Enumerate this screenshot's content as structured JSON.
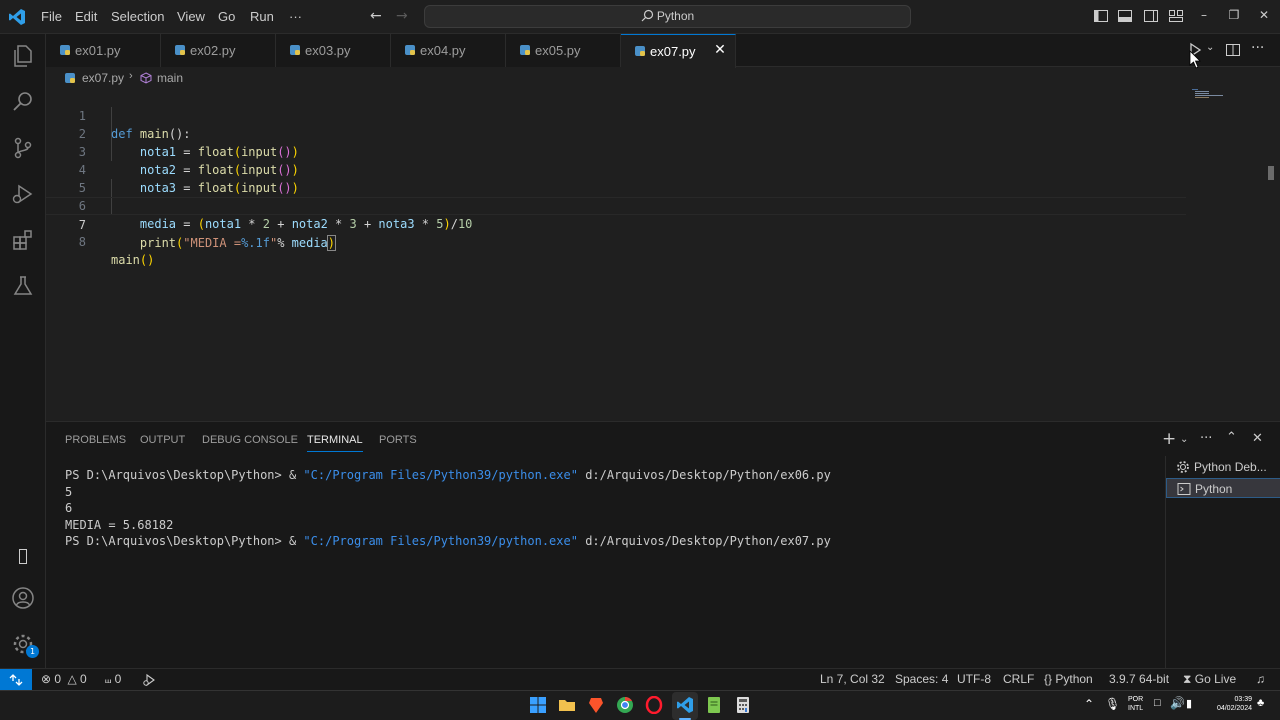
{
  "menu": [
    "File",
    "Edit",
    "Selection",
    "View",
    "Go",
    "Run",
    "···"
  ],
  "search": {
    "text": "Python"
  },
  "tabs": [
    {
      "label": "ex01.py"
    },
    {
      "label": "ex02.py"
    },
    {
      "label": "ex03.py"
    },
    {
      "label": "ex04.py"
    },
    {
      "label": "ex05.py"
    },
    {
      "label": "ex07.py",
      "active": true
    }
  ],
  "breadcrumb": {
    "file": "ex07.py",
    "symbol": "main"
  },
  "code": {
    "line_numbers": [
      "1",
      "2",
      "3",
      "4",
      "5",
      "6",
      "7",
      "8"
    ],
    "l1": {
      "kw": "def",
      "fn": "main",
      "rest": "():"
    },
    "l2": {
      "var": "nota1",
      "op": " = ",
      "fn1": "float",
      "fn2": "input"
    },
    "l3": {
      "var": "nota2",
      "op": " = ",
      "fn1": "float",
      "fn2": "input"
    },
    "l4": {
      "var": "nota3",
      "op": " = ",
      "fn1": "float",
      "fn2": "input"
    },
    "l6": {
      "v0": "media",
      "v1": "nota1",
      "n1": "2",
      "v2": "nota2",
      "n2": "3",
      "v3": "nota3",
      "n3": "5",
      "n4": "10"
    },
    "l7": {
      "fn": "print",
      "str1": "\"MEDIA =",
      "fmt": "%.1f",
      "str2": "\"",
      "op": "% ",
      "var": "media"
    },
    "l8": {
      "fn": "main",
      "rest": "()"
    }
  },
  "panel": {
    "tabs": [
      "PROBLEMS",
      "OUTPUT",
      "DEBUG CONSOLE",
      "TERMINAL",
      "PORTS"
    ],
    "active_tab": "TERMINAL",
    "terminal": {
      "l1_prompt": "PS D:\\Arquivos\\Desktop\\Python> & ",
      "l1_str": "\"C:/Program Files/Python39/python.exe\"",
      "l1_path": " d:/Arquivos/Desktop/Python/ex06.py",
      "l2": "5",
      "l3": "6",
      "l4": "MEDIA = 5.68182",
      "l5_prompt": "PS D:\\Arquivos\\Desktop\\Python> & ",
      "l5_str": "\"C:/Program Files/Python39/python.exe\"",
      "l5_path": " d:/Arquivos/Desktop/Python/ex07.py"
    },
    "terminal_list": [
      "Python Deb...",
      "Python"
    ]
  },
  "status": {
    "errors": "0",
    "warnings": "0",
    "ports": "0",
    "position": "Ln 7, Col 32",
    "spaces": "Spaces: 4",
    "encoding": "UTF-8",
    "eol": "CRLF",
    "language": "Python",
    "interpreter": "3.9.7 64-bit",
    "golive": "Go Live"
  },
  "notification_badge": "1",
  "taskbar": {
    "lang_top": "POR",
    "lang_bottom": "INTL",
    "time": "03:39",
    "date": "04/02/2024"
  },
  "colors": {
    "accent": "#0078d4",
    "editor_bg": "#1f1f1f",
    "panel_bg": "#181818"
  }
}
